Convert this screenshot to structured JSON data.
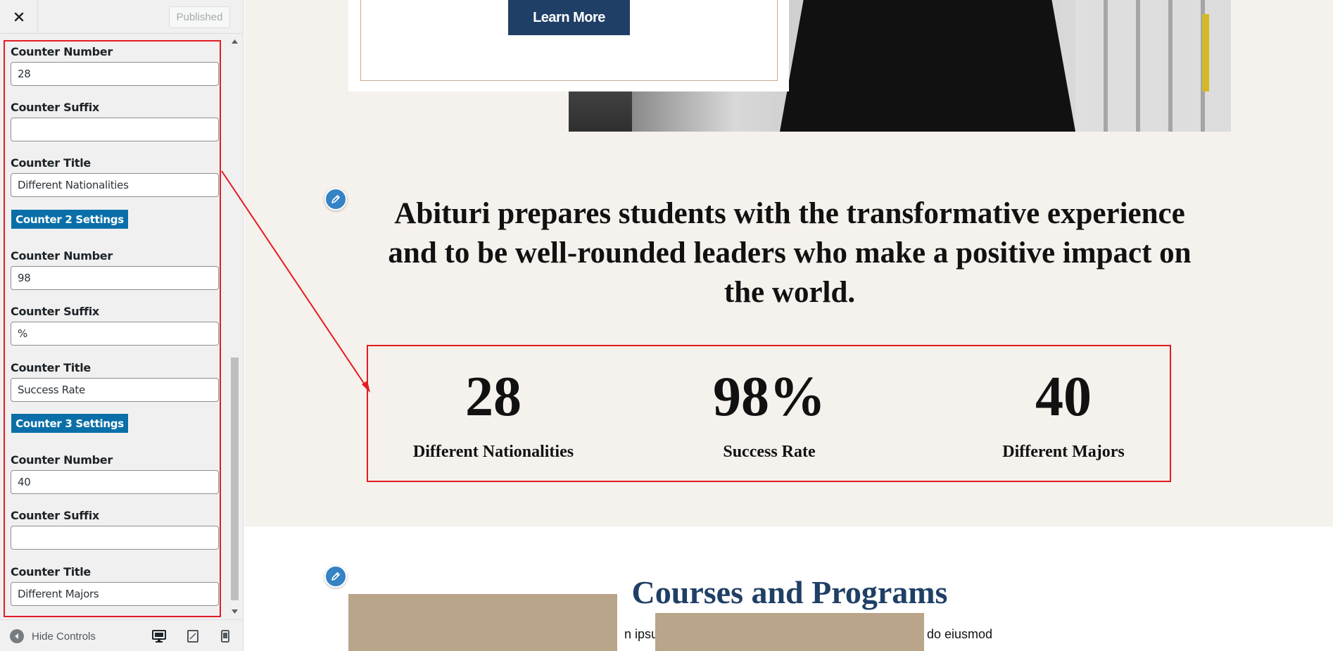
{
  "sidebar": {
    "published_label": "Published",
    "fields": [
      {
        "label": "Counter Number",
        "value": "28"
      },
      {
        "label": "Counter Suffix",
        "value": ""
      },
      {
        "label": "Counter Title",
        "value": "Different Nationalities"
      },
      {
        "label": "Counter Number",
        "value": "98"
      },
      {
        "label": "Counter Suffix",
        "value": "%"
      },
      {
        "label": "Counter Title",
        "value": "Success Rate"
      },
      {
        "label": "Counter Number",
        "value": "40"
      },
      {
        "label": "Counter Suffix",
        "value": ""
      },
      {
        "label": "Counter Title",
        "value": "Different Majors"
      }
    ],
    "section_buttons": [
      "Counter 2 Settings",
      "Counter 3 Settings"
    ],
    "footer": {
      "hide_controls_label": "Hide Controls"
    },
    "icons": {
      "close": "close-icon",
      "hide": "collapse-icon",
      "desktop": "desktop-icon",
      "tablet": "tablet-icon",
      "mobile": "mobile-icon"
    }
  },
  "preview": {
    "learn_more_label": "Learn More",
    "headline": "Abituri prepares students with the transformative experience and to be well-rounded leaders who make a positive impact on the world.",
    "counters": [
      {
        "number": "28",
        "title": "Different Nationalities"
      },
      {
        "number": "98%",
        "title": "Success Rate"
      },
      {
        "number": "40",
        "title": "Different Majors"
      }
    ],
    "courses_title": "Courses and Programs",
    "lorem_left": "n ipsum",
    "lorem_right": "do eiusmod"
  },
  "colors": {
    "highlight": "#e31b23",
    "accent_blue": "#0a6fa8",
    "navy": "#1f3f66",
    "beige": "#f5f1ec",
    "tan": "#b9a58a"
  }
}
